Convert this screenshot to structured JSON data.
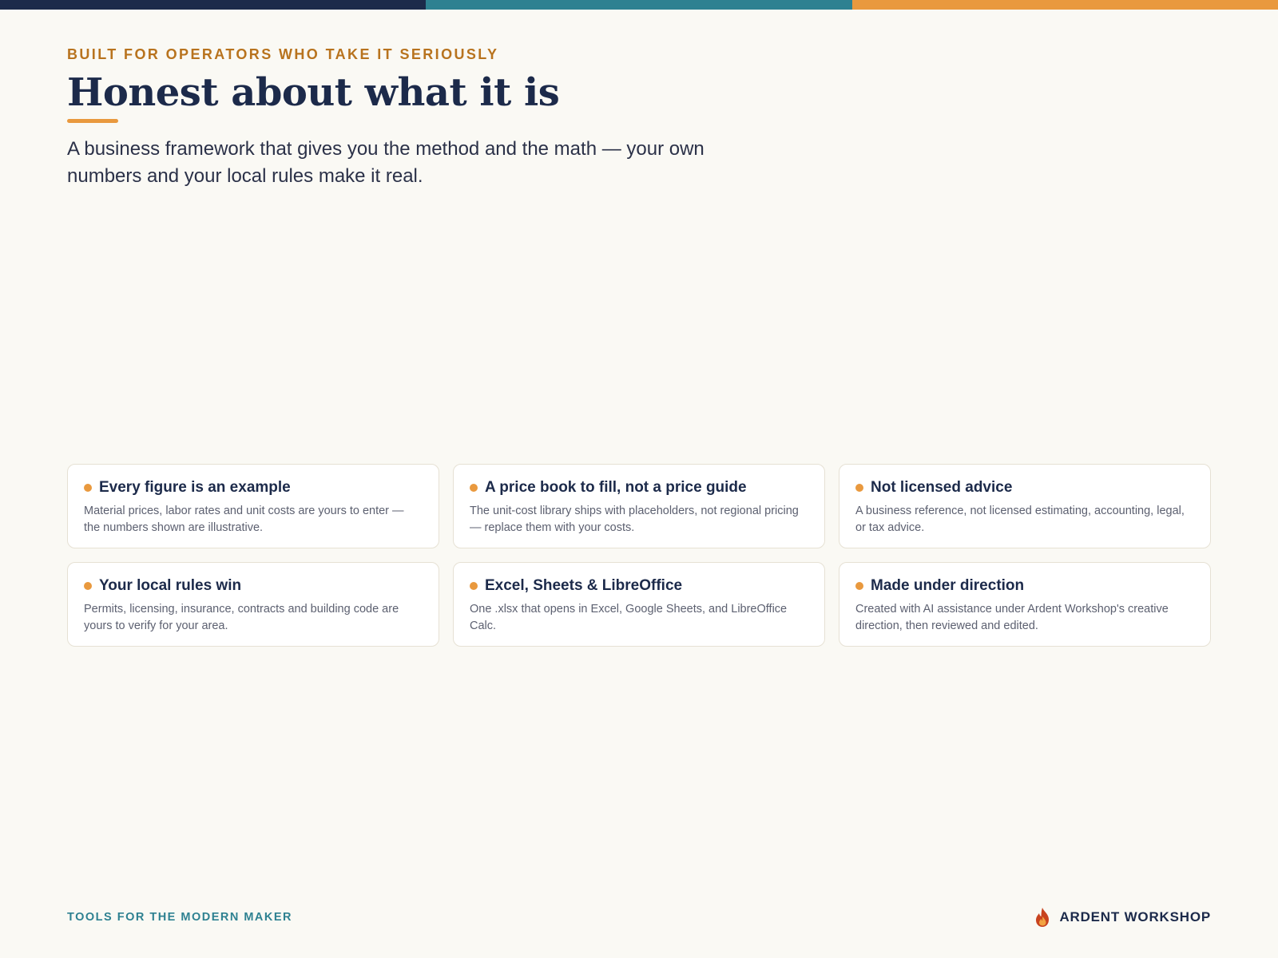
{
  "colors": {
    "navy": "#1c2a4a",
    "teal": "#2e8191",
    "orange": "#e9993e",
    "eyebrow_gold": "#b8731e",
    "background": "#faf9f4"
  },
  "header": {
    "eyebrow": "BUILT FOR OPERATORS WHO TAKE IT SERIOUSLY",
    "title": "Honest about what it is",
    "subtitle": "A business framework that gives you the method and the math — your own numbers and your local rules make it real."
  },
  "cards": [
    {
      "title": "Every figure is an example",
      "body": "Material prices, labor rates and unit costs are yours to enter — the numbers shown are illustrative."
    },
    {
      "title": "A price book to fill, not a price guide",
      "body": "The unit-cost library ships with placeholders, not regional pricing — replace them with your costs."
    },
    {
      "title": "Not licensed advice",
      "body": "A business reference, not licensed estimating, accounting, legal, or tax advice."
    },
    {
      "title": "Your local rules win",
      "body": "Permits, licensing, insurance, contracts and building code are yours to verify for your area."
    },
    {
      "title": "Excel, Sheets & LibreOffice",
      "body": "One .xlsx that opens in Excel, Google Sheets, and LibreOffice Calc."
    },
    {
      "title": "Made under direction",
      "body": "Created with AI assistance under Ardent Workshop's creative direction, then reviewed and edited."
    }
  ],
  "footer": {
    "tagline": "TOOLS FOR THE MODERN MAKER",
    "brand_name": "ARDENT WORKSHOP",
    "brand_icon": "flame-icon"
  }
}
